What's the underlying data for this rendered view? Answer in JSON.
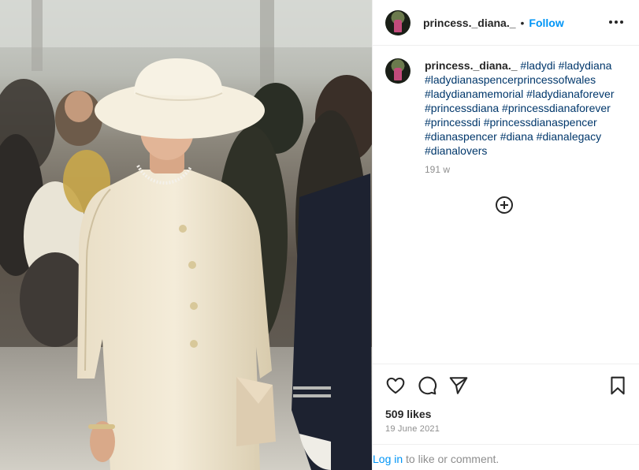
{
  "post": {
    "username": "princess._diana._",
    "separator": "•",
    "follow_label": "Follow",
    "more_label": "•••",
    "caption_user": "princess._diana._",
    "caption_hashtags": "#ladydi #ladydiana #ladydianaspencerprincessofwales #ladydianamemorial #ladydianaforever #princessdiana #princessdianaforever #princessdi #princessdianaspencer #dianaspencer #diana #dianalegacy #dianalovers",
    "time_ago": "191 w",
    "likes": "509 likes",
    "date": "19 June 2021",
    "login_link": "Log in",
    "login_suffix": " to like or comment."
  },
  "icons": {
    "avatar": "avatar-image",
    "more": "more-options-icon",
    "plus": "plus-circle-icon",
    "like": "heart-icon",
    "comment": "comment-icon",
    "share": "share-icon",
    "save": "bookmark-icon"
  },
  "colors": {
    "link_blue": "#0095f6",
    "hashtag_blue": "#00376b",
    "muted_text": "#8e8e8e",
    "divider": "#efefef"
  }
}
